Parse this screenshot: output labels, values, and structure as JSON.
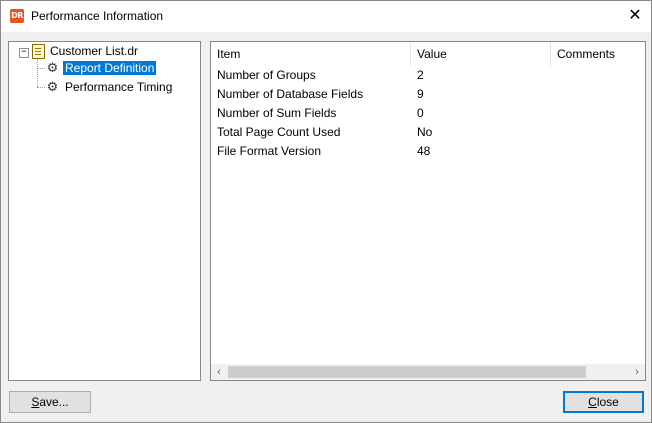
{
  "window": {
    "title": "Performance Information",
    "app_icon_text": "DR"
  },
  "tree": {
    "root": "Customer List.dr",
    "children": [
      "Report Definition",
      "Performance Timing"
    ],
    "selected_index": 0
  },
  "list": {
    "columns": [
      "Item",
      "Value",
      "Comments"
    ],
    "rows": [
      {
        "item": "Number of Groups",
        "value": "2",
        "comments": ""
      },
      {
        "item": "Number of Database Fields",
        "value": "9",
        "comments": ""
      },
      {
        "item": "Number of Sum Fields",
        "value": "0",
        "comments": ""
      },
      {
        "item": "Total Page Count Used",
        "value": "No",
        "comments": ""
      },
      {
        "item": "File Format Version",
        "value": "48",
        "comments": ""
      }
    ]
  },
  "buttons": {
    "save_prefix": "S",
    "save_rest": "ave...",
    "close_prefix": "C",
    "close_rest": "lose"
  },
  "icons": {
    "close": "close-icon",
    "expander": "collapse-icon",
    "document": "document-icon",
    "gear": "gear-icon",
    "scroll_left": "chevron-left-icon",
    "scroll_right": "chevron-right-icon"
  },
  "colors": {
    "selection": "#0078d7",
    "app_icon": "#e8541c"
  }
}
